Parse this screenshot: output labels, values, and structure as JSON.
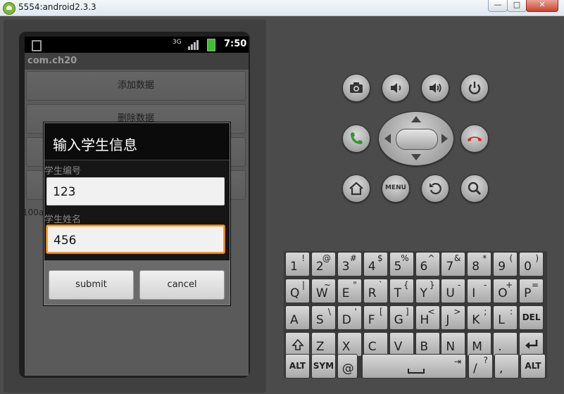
{
  "window": {
    "title": "5554:android2.3.3",
    "min_label": "—",
    "max_label": "□",
    "close_label": "✕"
  },
  "status_bar": {
    "network_label": "3G",
    "time": "7:50"
  },
  "app": {
    "title": "com.ch20",
    "buttons": [
      "添加数据",
      "删除数据",
      "",
      ""
    ],
    "background_text": "100a"
  },
  "dialog": {
    "title": "输入学生信息",
    "field1_label": "学生编号",
    "field1_value": "123",
    "field2_label": "学生姓名",
    "field2_value": "456",
    "submit_label": "submit",
    "cancel_label": "cancel"
  },
  "hardware_buttons": {
    "row1": [
      "camera-icon",
      "volume-down-icon",
      "volume-up-icon",
      "power-icon"
    ],
    "row2": [
      "call-icon",
      "dpad",
      "end-call-icon"
    ],
    "row3": [
      "home-icon",
      "menu-button",
      "back-icon",
      "search-icon"
    ],
    "menu_label": "MENU",
    "call_color": "#2f9a2f",
    "end_call_color": "#d22b2b"
  },
  "keyboard": {
    "row1": [
      [
        "1",
        "!"
      ],
      [
        "2",
        "@"
      ],
      [
        "3",
        "#"
      ],
      [
        "4",
        "$"
      ],
      [
        "5",
        "%"
      ],
      [
        "6",
        "^"
      ],
      [
        "7",
        "&"
      ],
      [
        "8",
        "*"
      ],
      [
        "9",
        "("
      ],
      [
        "0",
        ")"
      ]
    ],
    "row2": [
      [
        "Q",
        "|"
      ],
      [
        "W",
        "~"
      ],
      [
        "E",
        "\""
      ],
      [
        "R",
        "`"
      ],
      [
        "T",
        "{"
      ],
      [
        "Y",
        "}"
      ],
      [
        "U",
        "-"
      ],
      [
        "I",
        "-"
      ],
      [
        "O",
        "+"
      ],
      [
        "P",
        "="
      ]
    ],
    "row3": [
      [
        "A",
        ""
      ],
      [
        "S",
        "\\"
      ],
      [
        "D",
        "'"
      ],
      [
        "F",
        "["
      ],
      [
        "G",
        "]"
      ],
      [
        "H",
        "<"
      ],
      [
        "J",
        ">"
      ],
      [
        "K",
        ";"
      ],
      [
        "L",
        ":"
      ]
    ],
    "del_label": "DEL",
    "row4": [
      [
        "Z",
        ""
      ],
      [
        "X",
        ""
      ],
      [
        "C",
        ""
      ],
      [
        "V",
        ""
      ],
      [
        "B",
        ""
      ],
      [
        "N",
        ""
      ],
      [
        "M",
        ""
      ],
      [
        ".",
        ""
      ]
    ],
    "alt_label": "ALT",
    "sym_label": "SYM",
    "at_label": "@",
    "slash_label": "/",
    "slash_sub": "?",
    "comma_label": ","
  }
}
